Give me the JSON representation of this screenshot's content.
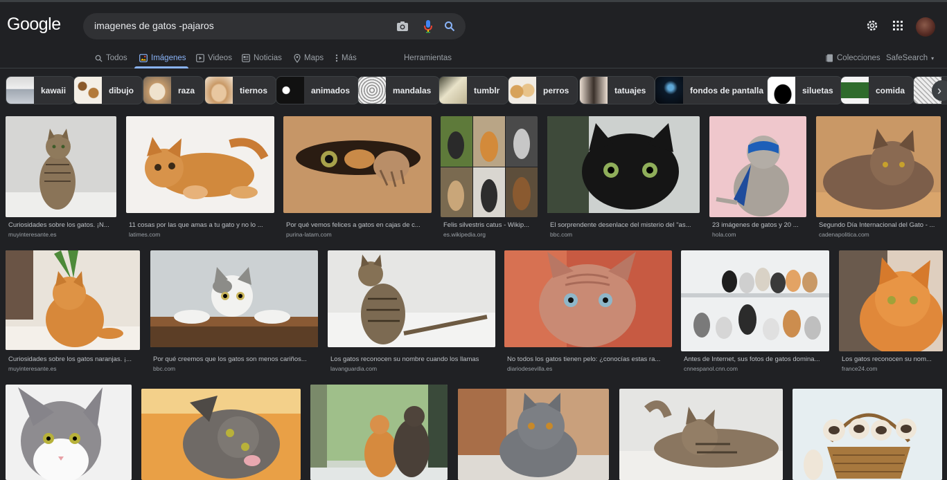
{
  "header": {
    "logo": "Google",
    "query": "imagenes de gatos  -pajaros"
  },
  "tabs": [
    {
      "label": "Todos",
      "icon": "search-icon"
    },
    {
      "label": "Imágenes",
      "icon": "image-icon"
    },
    {
      "label": "Videos",
      "icon": "video-icon"
    },
    {
      "label": "Noticias",
      "icon": "news-icon"
    },
    {
      "label": "Maps",
      "icon": "map-pin-icon"
    },
    {
      "label": "Más",
      "icon": "more-dots-icon"
    },
    {
      "label": "Herramientas",
      "icon": ""
    }
  ],
  "tabs_right": {
    "collections": "Colecciones",
    "safesearch": "SafeSearch"
  },
  "chips": [
    "kawaii",
    "dibujo",
    "raza",
    "tiernos",
    "animados",
    "mandalas",
    "tumblr",
    "perros",
    "tatuajes",
    "fondos de pantalla",
    "siluetas",
    "comida"
  ],
  "results": [
    {
      "title": "Curiosidades sobre los gatos. ¡N...",
      "source": "muyinteresante.es"
    },
    {
      "title": "11 cosas por las que amas a tu gato y no lo ...",
      "source": "latimes.com"
    },
    {
      "title": "Por qué vemos felices a gatos en cajas de c...",
      "source": "purina-latam.com"
    },
    {
      "title": "Felis silvestris catus - Wikip...",
      "source": "es.wikipedia.org"
    },
    {
      "title": "El sorprendente desenlace del misterio del \"as...",
      "source": "bbc.com"
    },
    {
      "title": "23 imágenes de gatos y 20 ...",
      "source": "hola.com"
    },
    {
      "title": "Segundo Día Internacional del Gato - ...",
      "source": "cadenapolitica.com"
    },
    {
      "title": "Curiosidades sobre los gatos naranjas. ¡...",
      "source": "muyinteresante.es"
    },
    {
      "title": "Por qué creemos que los gatos son menos cariños...",
      "source": "bbc.com"
    },
    {
      "title": "Los gatos reconocen su nombre cuando los llamas",
      "source": "lavanguardia.com"
    },
    {
      "title": "No todos los gatos tienen pelo: ¿conocías estas ra...",
      "source": "diariodesevilla.es"
    },
    {
      "title": "Antes de Internet, sus fotos de gatos domina...",
      "source": "cnnespanol.cnn.com"
    },
    {
      "title": "Los gatos reconocen su nom...",
      "source": "france24.com"
    },
    {
      "title": "",
      "source": ""
    },
    {
      "title": "",
      "source": ""
    },
    {
      "title": "",
      "source": ""
    },
    {
      "title": "",
      "source": ""
    },
    {
      "title": "",
      "source": ""
    },
    {
      "title": "",
      "source": ""
    }
  ],
  "colors": {
    "background": "#202124",
    "search_box": "#303134",
    "accent_blue": "#8ab4f8",
    "text_primary": "#e8eaed",
    "text_secondary": "#9aa0a6"
  }
}
